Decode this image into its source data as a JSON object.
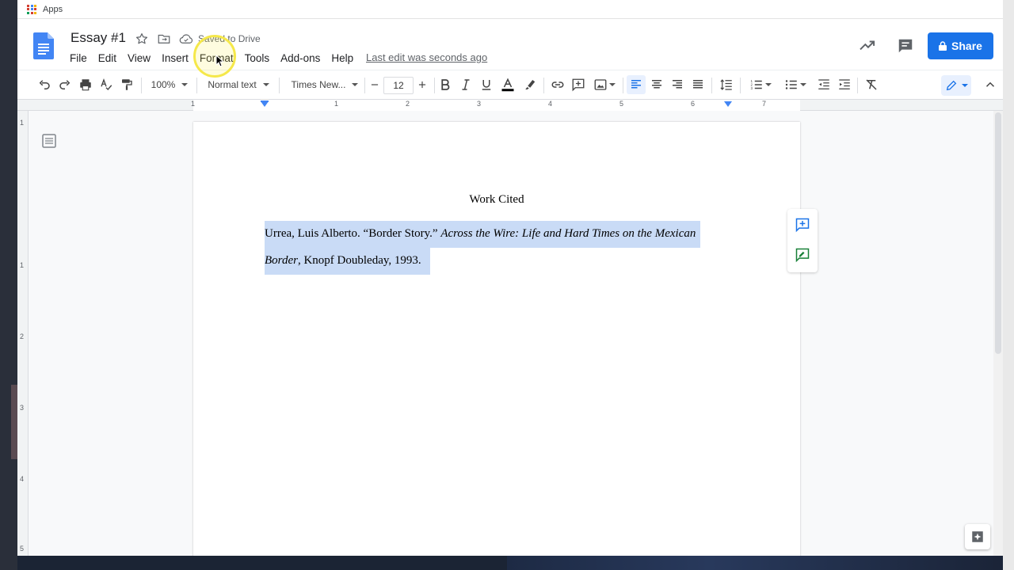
{
  "bookmarks": {
    "apps_label": "Apps"
  },
  "doc": {
    "title": "Essay #1",
    "save_status": "Saved to Drive",
    "last_edit": "Last edit was seconds ago"
  },
  "menu": [
    "File",
    "Edit",
    "View",
    "Insert",
    "Format",
    "Tools",
    "Add-ons",
    "Help"
  ],
  "share": {
    "label": "Share"
  },
  "toolbar": {
    "zoom": "100%",
    "style": "Normal text",
    "font": "Times New...",
    "font_size": "12"
  },
  "ruler": {
    "labels": [
      "1",
      "1",
      "2",
      "3",
      "4",
      "5",
      "6",
      "7"
    ]
  },
  "vruler": {
    "labels": [
      "1",
      "1",
      "2",
      "3",
      "4",
      "5"
    ]
  },
  "body": {
    "heading": "Work Cited",
    "citation": {
      "part1": "Urrea, Luis Alberto. “Border Story.” ",
      "part1_italic": "Across the Wire: Life and Hard Times on the Mexican",
      "part2_italic": "Border",
      "part2": ", Knopf Doubleday, 1993."
    }
  },
  "colors": {
    "accent": "#1a73e8",
    "selection": "#c9dbf6",
    "cursor_highlight": "#f5e84a"
  }
}
